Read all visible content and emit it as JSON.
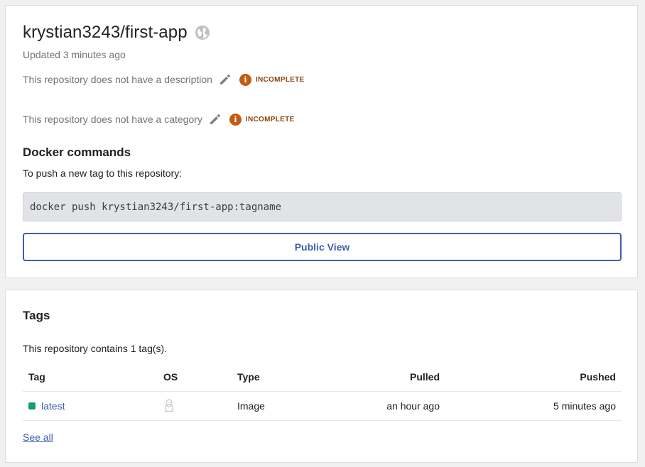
{
  "repo": {
    "name": "krystian3243/first-app",
    "updated": "Updated 3 minutes ago",
    "description_text": "This repository does not have a description",
    "category_text": "This repository does not have a category",
    "incomplete_label": "INCOMPLETE",
    "badge_glyph": "i"
  },
  "docker": {
    "title": "Docker commands",
    "push_instructions": "To push a new tag to this repository:",
    "command": "docker push krystian3243/first-app:tagname",
    "public_view_label": "Public View"
  },
  "tags": {
    "title": "Tags",
    "count_text": "This repository contains 1 tag(s).",
    "columns": [
      "Tag",
      "OS",
      "Type",
      "Pulled",
      "Pushed"
    ],
    "rows": [
      {
        "tag": "latest",
        "os_icon": "linux-tux-icon",
        "type": "Image",
        "pulled": "an hour ago",
        "pushed": "5 minutes ago"
      }
    ],
    "see_all_label": "See all"
  },
  "colors": {
    "accent": "#3e5fb0",
    "warning": "#c25b14",
    "tag_status": "#1a9a7a"
  },
  "icons": {
    "visibility": "globe-icon",
    "edit": "pencil-icon"
  }
}
